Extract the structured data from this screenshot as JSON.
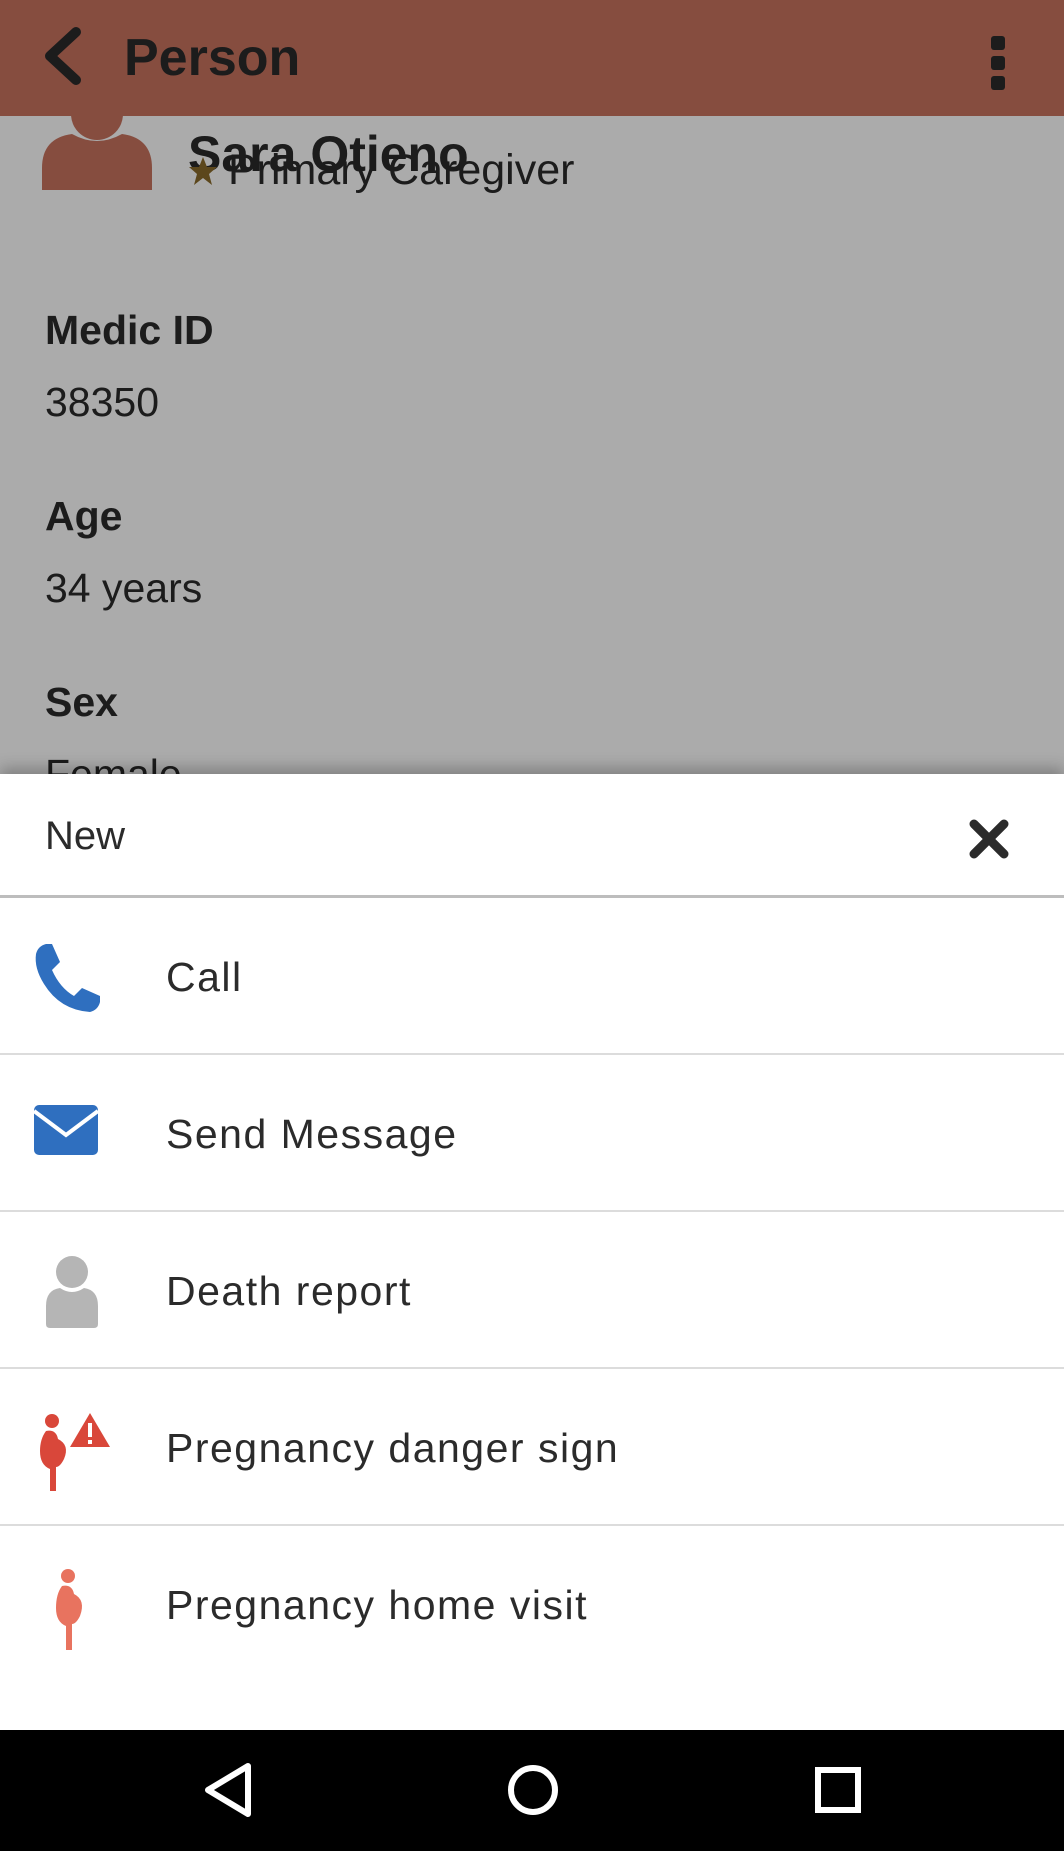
{
  "app_bar": {
    "title": "Person",
    "back_icon": "chevron-left-icon",
    "menu_icon": "more-vertical-icon",
    "color": "#c8735f"
  },
  "person": {
    "name": "Sara Otieno",
    "role": "Primary Caregiver",
    "avatar_icon": "person-icon",
    "role_icon": "star-icon",
    "fields": [
      {
        "label": "Medic ID",
        "value": "38350"
      },
      {
        "label": "Age",
        "value": "34 years"
      },
      {
        "label": "Sex",
        "value": "Female"
      }
    ]
  },
  "sheet": {
    "title": "New",
    "close_icon": "close-icon",
    "actions": [
      {
        "label": "Call",
        "icon": "phone-icon",
        "color": "#2f6fbf"
      },
      {
        "label": "Send Message",
        "icon": "envelope-icon",
        "color": "#2f6fbf"
      },
      {
        "label": "Death report",
        "icon": "person-gray-icon",
        "color": "#b5b5b5"
      },
      {
        "label": "Pregnancy danger sign",
        "icon": "pregnancy-danger-icon",
        "color": "#d9473a"
      },
      {
        "label": "Pregnancy home visit",
        "icon": "pregnancy-icon",
        "color": "#e8735f"
      }
    ]
  },
  "system_nav": {
    "back_icon": "triangle-back-icon",
    "home_icon": "circle-home-icon",
    "recents_icon": "square-recents-icon"
  }
}
